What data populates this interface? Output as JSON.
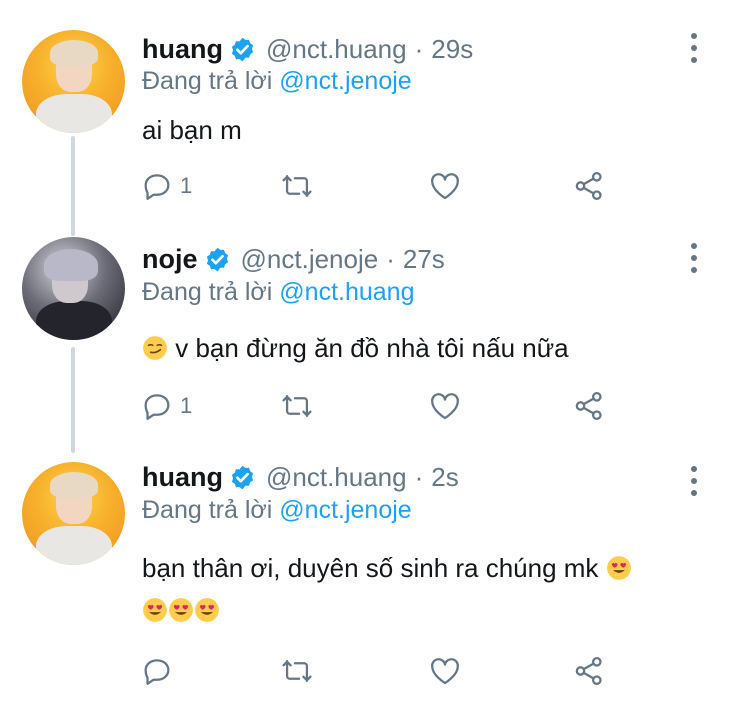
{
  "tweets": [
    {
      "name": "huang",
      "handle": "@nct.huang",
      "separator": "·",
      "time": "29s",
      "replying_prefix": "Đang trả lời",
      "replying_to": "@nct.jenoje",
      "text": "ai bạn m",
      "reply_count": "1",
      "avatar": "avatar-huang"
    },
    {
      "name": "noje",
      "handle": "@nct.jenoje",
      "separator": "·",
      "time": "27s",
      "replying_prefix": "Đang trả lời",
      "replying_to": "@nct.huang",
      "text": "v bạn đừng ăn đồ nhà tôi nấu nữa",
      "reply_count": "1",
      "avatar": "avatar-noje"
    },
    {
      "name": "huang",
      "handle": "@nct.huang",
      "separator": "·",
      "time": "2s",
      "replying_prefix": "Đang trả lời",
      "replying_to": "@nct.jenoje",
      "text": "bạn thân ơi, duyên số sinh ra chúng mk",
      "reply_count": "",
      "avatar": "avatar-huang"
    }
  ],
  "icons": {
    "verified": "verified-badge-icon",
    "reply": "reply-icon",
    "retweet": "retweet-icon",
    "like": "heart-icon",
    "share": "share-icon",
    "more": "more-vertical-icon"
  },
  "colors": {
    "link": "#1da1f2",
    "muted": "#657786",
    "text": "#14171a",
    "thread_line": "#cfd9de",
    "verified": "#1da1f2"
  }
}
